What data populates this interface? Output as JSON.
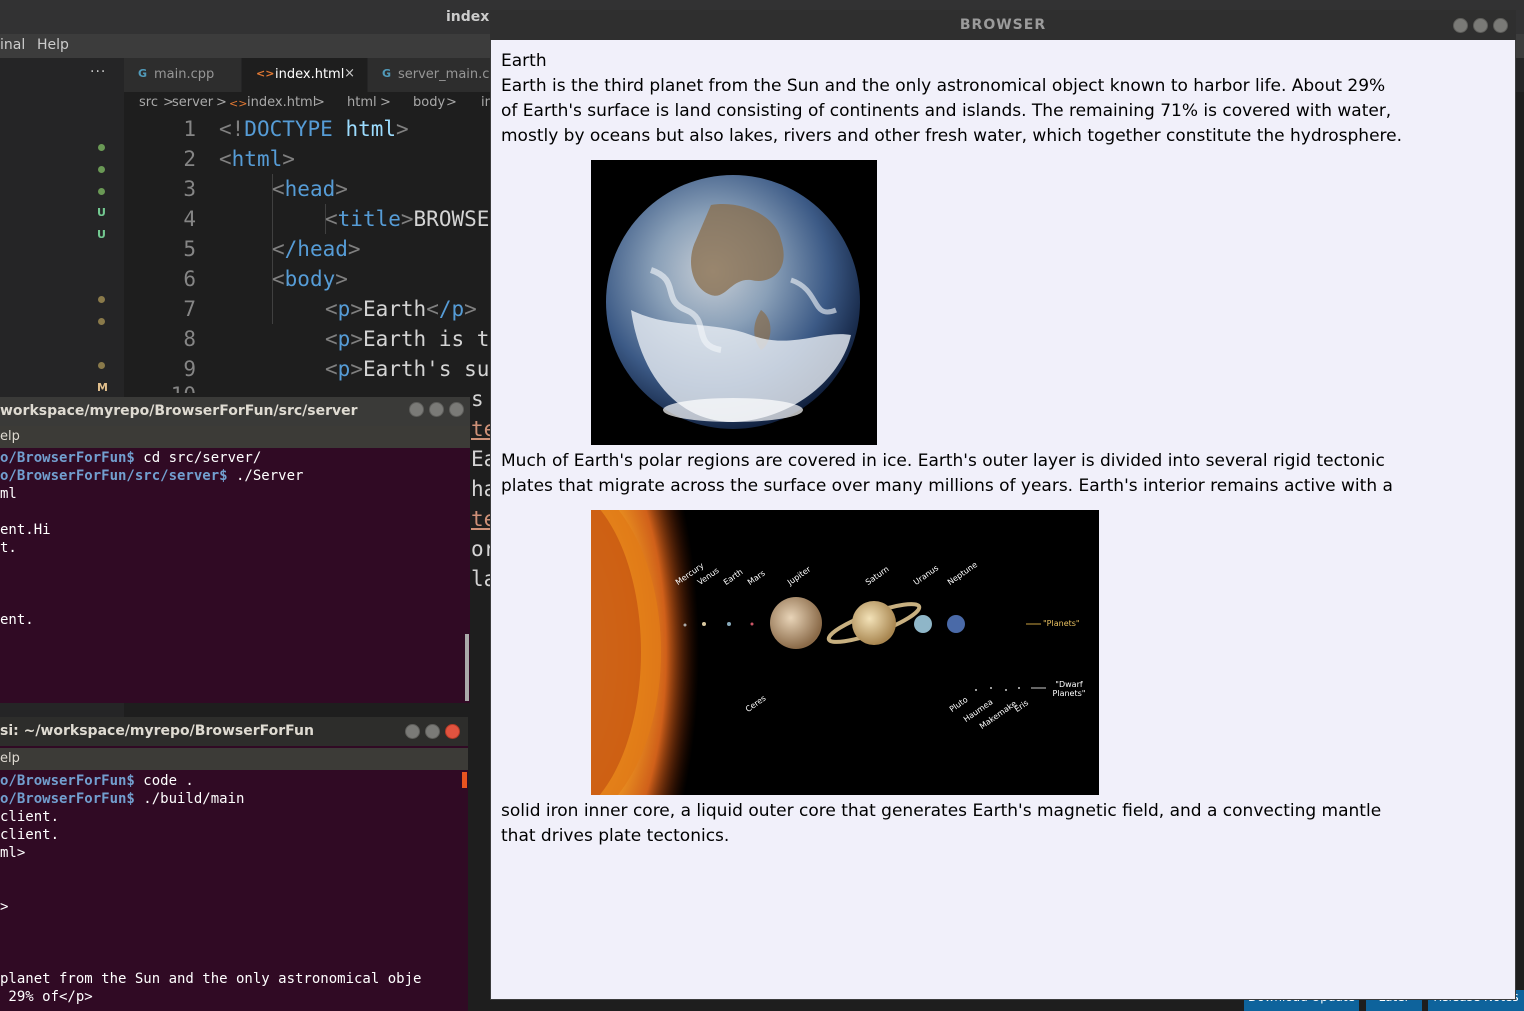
{
  "vscode": {
    "title": "index.html",
    "menu": [
      "inal",
      "Help"
    ],
    "sidebar_more": "···",
    "git_marks": [
      "U",
      "U",
      "M"
    ],
    "tabs": [
      {
        "icon": "G",
        "label": "main.cpp"
      },
      {
        "icon": "<>",
        "label": "index.html",
        "close": "×"
      },
      {
        "icon": "G",
        "label": "server_main.cpp"
      }
    ],
    "breadcrumb": [
      "src",
      ">",
      "server",
      ">",
      "<>",
      "index.html",
      ">",
      "html",
      ">",
      "body",
      ">",
      "in"
    ],
    "lines": [
      "1",
      "2",
      "3",
      "4",
      "5",
      "6",
      "7",
      "8",
      "9",
      "10"
    ],
    "code": {
      "l1a": "<!",
      "l1b": "DOCTYPE",
      "l1c": " html",
      "l1d": ">",
      "l2": "html",
      "l3": "head",
      "l4tag": "title",
      "l4text": "BROWSE",
      "l5": "/head",
      "l6": "body",
      "l7tag": "p",
      "l7text": "Earth",
      "l7close": "/p",
      "l8tag": "p",
      "l8text": "Earth is t",
      "l9tag": "p",
      "l9text": "Earth's su",
      "l10": "s"
    },
    "code_partial": [
      "te",
      "Ea",
      "ha",
      "te",
      "or",
      "la"
    ],
    "notifications": [
      "Download Update",
      "Later",
      "Release Notes"
    ]
  },
  "terminal_server": {
    "title": "workspace/myrepo/BrowserForFun/src/server",
    "menu": "elp",
    "lines": [
      {
        "prompt": "o/BrowserForFun$",
        "cmd": " cd src/server/"
      },
      {
        "prompt": "o/BrowserForFun/src/server$",
        "cmd": " ./Server"
      },
      {
        "prompt": "",
        "cmd": "ml"
      },
      {
        "prompt": "",
        "cmd": ""
      },
      {
        "prompt": "",
        "cmd": "ent.Hi"
      },
      {
        "prompt": "",
        "cmd": "t."
      },
      {
        "prompt": "",
        "cmd": ""
      },
      {
        "prompt": "",
        "cmd": ""
      },
      {
        "prompt": "",
        "cmd": ""
      },
      {
        "prompt": "",
        "cmd": "ent."
      }
    ]
  },
  "terminal_client": {
    "title": "si: ~/workspace/myrepo/BrowserForFun",
    "menu": "elp",
    "lines": [
      {
        "prompt": "o/BrowserForFun$",
        "cmd": " code ."
      },
      {
        "prompt": "o/BrowserForFun$",
        "cmd": " ./build/main"
      },
      {
        "prompt": "",
        "cmd": "client."
      },
      {
        "prompt": "",
        "cmd": "client."
      },
      {
        "prompt": "",
        "cmd": "ml>"
      },
      {
        "prompt": "",
        "cmd": ""
      },
      {
        "prompt": "",
        "cmd": ""
      },
      {
        "prompt": "",
        "cmd": ">"
      }
    ],
    "bottom": [
      "planet from the Sun and the only astronomical obje",
      " 29% of</p>"
    ]
  },
  "browser": {
    "title": "BROWSER",
    "heading": "Earth",
    "para1": "Earth is the third planet from the Sun and the only astronomical object known to harbor life. About 29% of Earth's surface is land consisting of continents and islands. The remaining 71% is covered with water, mostly by oceans but also lakes, rivers and other fresh water, which together constitute the hydrosphere.",
    "para2": "Much of Earth's polar regions are covered in ice. Earth's outer layer is divided into several rigid tectonic plates that migrate across the surface over many millions of years. Earth's interior remains active with a",
    "para3": "solid iron inner core, a liquid outer core that generates Earth's magnetic field, and a convecting mantle that drives plate tectonics.",
    "solar_labels": {
      "planets": [
        "Mercury",
        "Venus",
        "Earth",
        "Mars",
        "Jupiter",
        "Saturn",
        "Uranus",
        "Neptune"
      ],
      "planets_group": "\"Planets\"",
      "dwarf": [
        "Ceres",
        "Pluto",
        "Haumea",
        "Makemake",
        "Eris"
      ],
      "dwarf_group": "\"Dwarf Planets\""
    }
  },
  "colors": {
    "terminal_bg": "#300a24",
    "browser_bg": "#f1f0fa",
    "editor_bg": "#1e1e1e"
  }
}
